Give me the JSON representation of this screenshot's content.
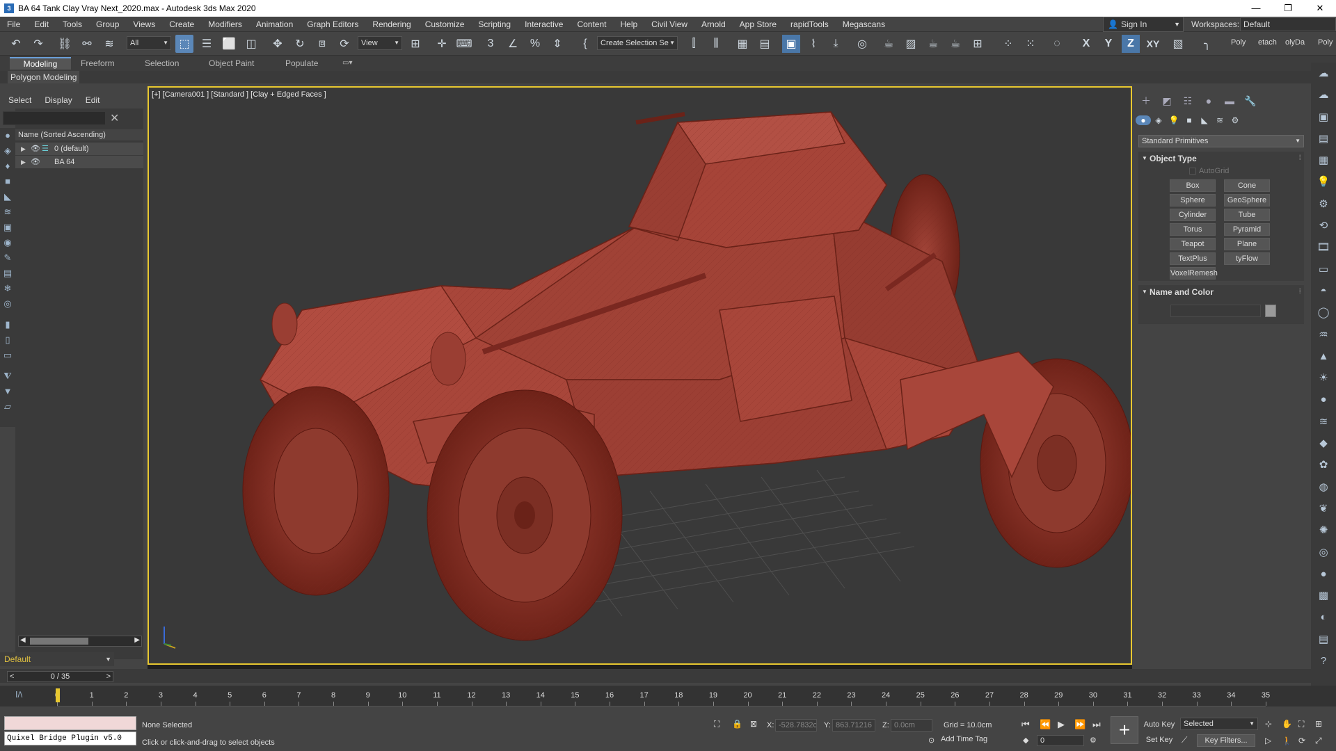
{
  "window": {
    "title": "BA 64 Tank Clay Vray Next_2020.max - Autodesk 3ds Max 2020",
    "minimize": "—",
    "maximize": "❐",
    "close": "✕"
  },
  "menubar": {
    "items": [
      "File",
      "Edit",
      "Tools",
      "Group",
      "Views",
      "Create",
      "Modifiers",
      "Animation",
      "Graph Editors",
      "Rendering",
      "Customize",
      "Scripting",
      "Interactive",
      "Content",
      "Help",
      "Civil View",
      "Arnold",
      "App Store",
      "rapidTools",
      "Megascans"
    ]
  },
  "account": {
    "signin": "Sign In",
    "workspaces_label": "Workspaces:",
    "workspace_value": "Default"
  },
  "toolbar": {
    "filter_value": "All",
    "view_value": "View",
    "named_sel_value": "Create Selection Se",
    "axis_x": "X",
    "axis_y": "Y",
    "axis_z": "Z",
    "axis_xy": "XY",
    "poly": "Poly",
    "etach": "etach",
    "olyda": "olyDa",
    "poly2": "Poly"
  },
  "ribbon": {
    "tabs": [
      "Modeling",
      "Freeform",
      "Selection",
      "Object Paint",
      "Populate"
    ],
    "sublabel": "Polygon Modeling"
  },
  "scene_explorer": {
    "menu": [
      "Select",
      "Display",
      "Edit"
    ],
    "column": "Name (Sorted Ascending)",
    "rows": [
      "0 (default)",
      "BA 64"
    ],
    "layer": "Default"
  },
  "viewport": {
    "label": "[+] [Camera001 ] [Standard ] [Clay + Edged Faces ]",
    "model_color": "#a8463a",
    "wire_color": "#7a2820"
  },
  "command_panel": {
    "dropdown": "Standard Primitives",
    "object_type": "Object Type",
    "autogrid": "AutoGrid",
    "buttons": [
      "Box",
      "Cone",
      "Sphere",
      "GeoSphere",
      "Cylinder",
      "Tube",
      "Torus",
      "Pyramid",
      "Teapot",
      "Plane",
      "TextPlus",
      "tyFlow",
      "VoxelRemesh"
    ],
    "name_and_color": "Name and Color"
  },
  "timeline": {
    "frame_display": "0 / 35",
    "ticks": [
      0,
      1,
      2,
      3,
      4,
      5,
      6,
      7,
      8,
      9,
      10,
      11,
      12,
      13,
      14,
      15,
      16,
      17,
      18,
      19,
      20,
      21,
      22,
      23,
      24,
      25,
      26,
      27,
      28,
      29,
      30,
      31,
      32,
      33,
      34,
      35
    ]
  },
  "status": {
    "plugin": "Quixel Bridge Plugin v5.0",
    "selection": "None Selected",
    "prompt": "Click or click-and-drag to select objects",
    "x_label": "X:",
    "x_value": "-528.7832c",
    "y_label": "Y:",
    "y_value": "863.71216",
    "z_label": "Z:",
    "z_value": "0.0cm",
    "grid": "Grid = 10.0cm",
    "add_time_tag": "Add Time Tag",
    "auto_key": "Auto Key",
    "set_key": "Set Key",
    "selected_value": "Selected",
    "key_filters": "Key Filters...",
    "frame_value": "0"
  }
}
